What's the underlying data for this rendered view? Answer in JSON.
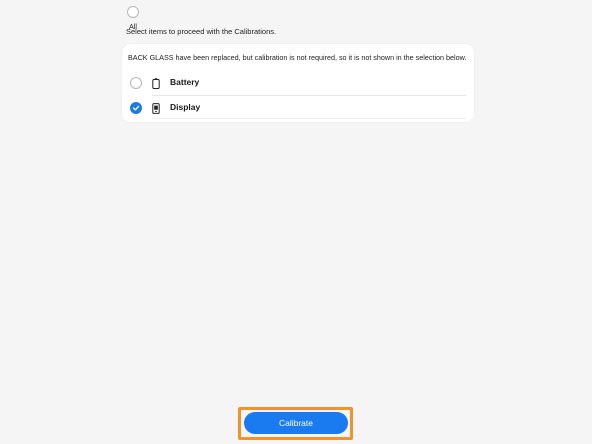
{
  "select_all": {
    "label": "All",
    "checked": false
  },
  "instruction": "Select items to proceed with the Calibrations.",
  "card": {
    "notice": "BACK GLASS have been replaced, but calibration is not required, so it is not shown in the selection below.",
    "items": [
      {
        "label": "Battery",
        "checked": false,
        "icon": "battery-icon"
      },
      {
        "label": "Display",
        "checked": true,
        "icon": "display-icon"
      }
    ]
  },
  "actions": {
    "calibrate_label": "Calibrate",
    "highlight_color": "#f0932a",
    "button_color": "#1a7bf0",
    "accent_check_color": "#1e7be0"
  }
}
